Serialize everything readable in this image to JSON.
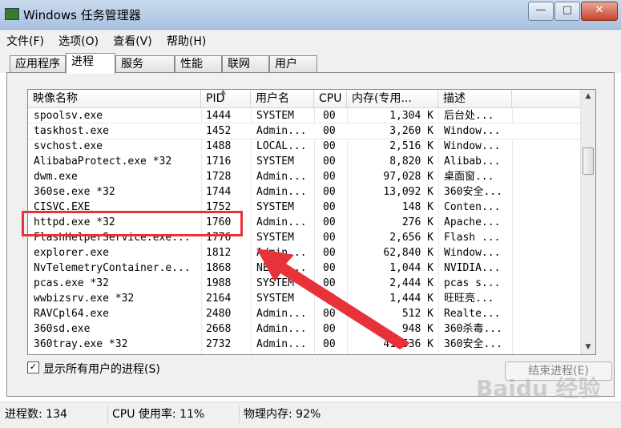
{
  "window": {
    "title": "Windows 任务管理器",
    "buttons": {
      "minimize": "—",
      "maximize": "□",
      "close": "✕"
    }
  },
  "menu": [
    "文件(F)",
    "选项(O)",
    "查看(V)",
    "帮助(H)"
  ],
  "tabs": [
    "应用程序",
    "进程",
    "服务",
    "性能",
    "联网",
    "用户"
  ],
  "active_tab": "进程",
  "columns": [
    "映像名称",
    "PID",
    "用户名",
    "CPU",
    "内存(专用...",
    "描述"
  ],
  "processes": [
    {
      "name": "spoolsv.exe",
      "pid": "1444",
      "user": "SYSTEM",
      "cpu": "00",
      "mem": "1,304 K",
      "desc": "后台处..."
    },
    {
      "name": "taskhost.exe",
      "pid": "1452",
      "user": "Admin...",
      "cpu": "00",
      "mem": "3,260 K",
      "desc": "Window..."
    },
    {
      "name": "svchost.exe",
      "pid": "1488",
      "user": "LOCAL...",
      "cpu": "00",
      "mem": "2,516 K",
      "desc": "Window..."
    },
    {
      "name": "AlibabaProtect.exe *32",
      "pid": "1716",
      "user": "SYSTEM",
      "cpu": "00",
      "mem": "8,820 K",
      "desc": "Alibab..."
    },
    {
      "name": "dwm.exe",
      "pid": "1728",
      "user": "Admin...",
      "cpu": "00",
      "mem": "97,028 K",
      "desc": "桌面窗..."
    },
    {
      "name": "360se.exe *32",
      "pid": "1744",
      "user": "Admin...",
      "cpu": "00",
      "mem": "13,092 K",
      "desc": "360安全..."
    },
    {
      "name": "CISVC.EXE",
      "pid": "1752",
      "user": "SYSTEM",
      "cpu": "00",
      "mem": "148 K",
      "desc": "Conten..."
    },
    {
      "name": "httpd.exe *32",
      "pid": "1760",
      "user": "Admin...",
      "cpu": "00",
      "mem": "276 K",
      "desc": "Apache..."
    },
    {
      "name": "FlashHelperService.exe...",
      "pid": "1776",
      "user": "SYSTEM",
      "cpu": "00",
      "mem": "2,656 K",
      "desc": "Flash ..."
    },
    {
      "name": "explorer.exe",
      "pid": "1812",
      "user": "Admin...",
      "cpu": "00",
      "mem": "62,840 K",
      "desc": "Window..."
    },
    {
      "name": "NvTelemetryContainer.e...",
      "pid": "1868",
      "user": "NETWO...",
      "cpu": "00",
      "mem": "1,044 K",
      "desc": "NVIDIA..."
    },
    {
      "name": "pcas.exe *32",
      "pid": "1988",
      "user": "SYSTEM",
      "cpu": "00",
      "mem": "2,444 K",
      "desc": "pcas s..."
    },
    {
      "name": "wwbizsrv.exe *32",
      "pid": "2164",
      "user": "SYSTEM",
      "cpu": "00",
      "mem": "1,444 K",
      "desc": "旺旺亮..."
    },
    {
      "name": "RAVCpl64.exe",
      "pid": "2480",
      "user": "Admin...",
      "cpu": "00",
      "mem": "512 K",
      "desc": "Realte..."
    },
    {
      "name": "360sd.exe",
      "pid": "2668",
      "user": "Admin...",
      "cpu": "00",
      "mem": "948 K",
      "desc": "360杀毒..."
    },
    {
      "name": "360tray.exe *32",
      "pid": "2732",
      "user": "Admin...",
      "cpu": "00",
      "mem": "41,536 K",
      "desc": "360安全..."
    }
  ],
  "show_all_users": {
    "label": "显示所有用户的进程(S)",
    "checked_mark": "✓"
  },
  "end_process_label": "结束进程(E)",
  "status": {
    "processes": "进程数: 134",
    "cpu": "CPU 使用率: 11%",
    "memory": "物理内存: 92%"
  },
  "watermark": "Baidu 经验",
  "highlight_color": "#e8323a"
}
